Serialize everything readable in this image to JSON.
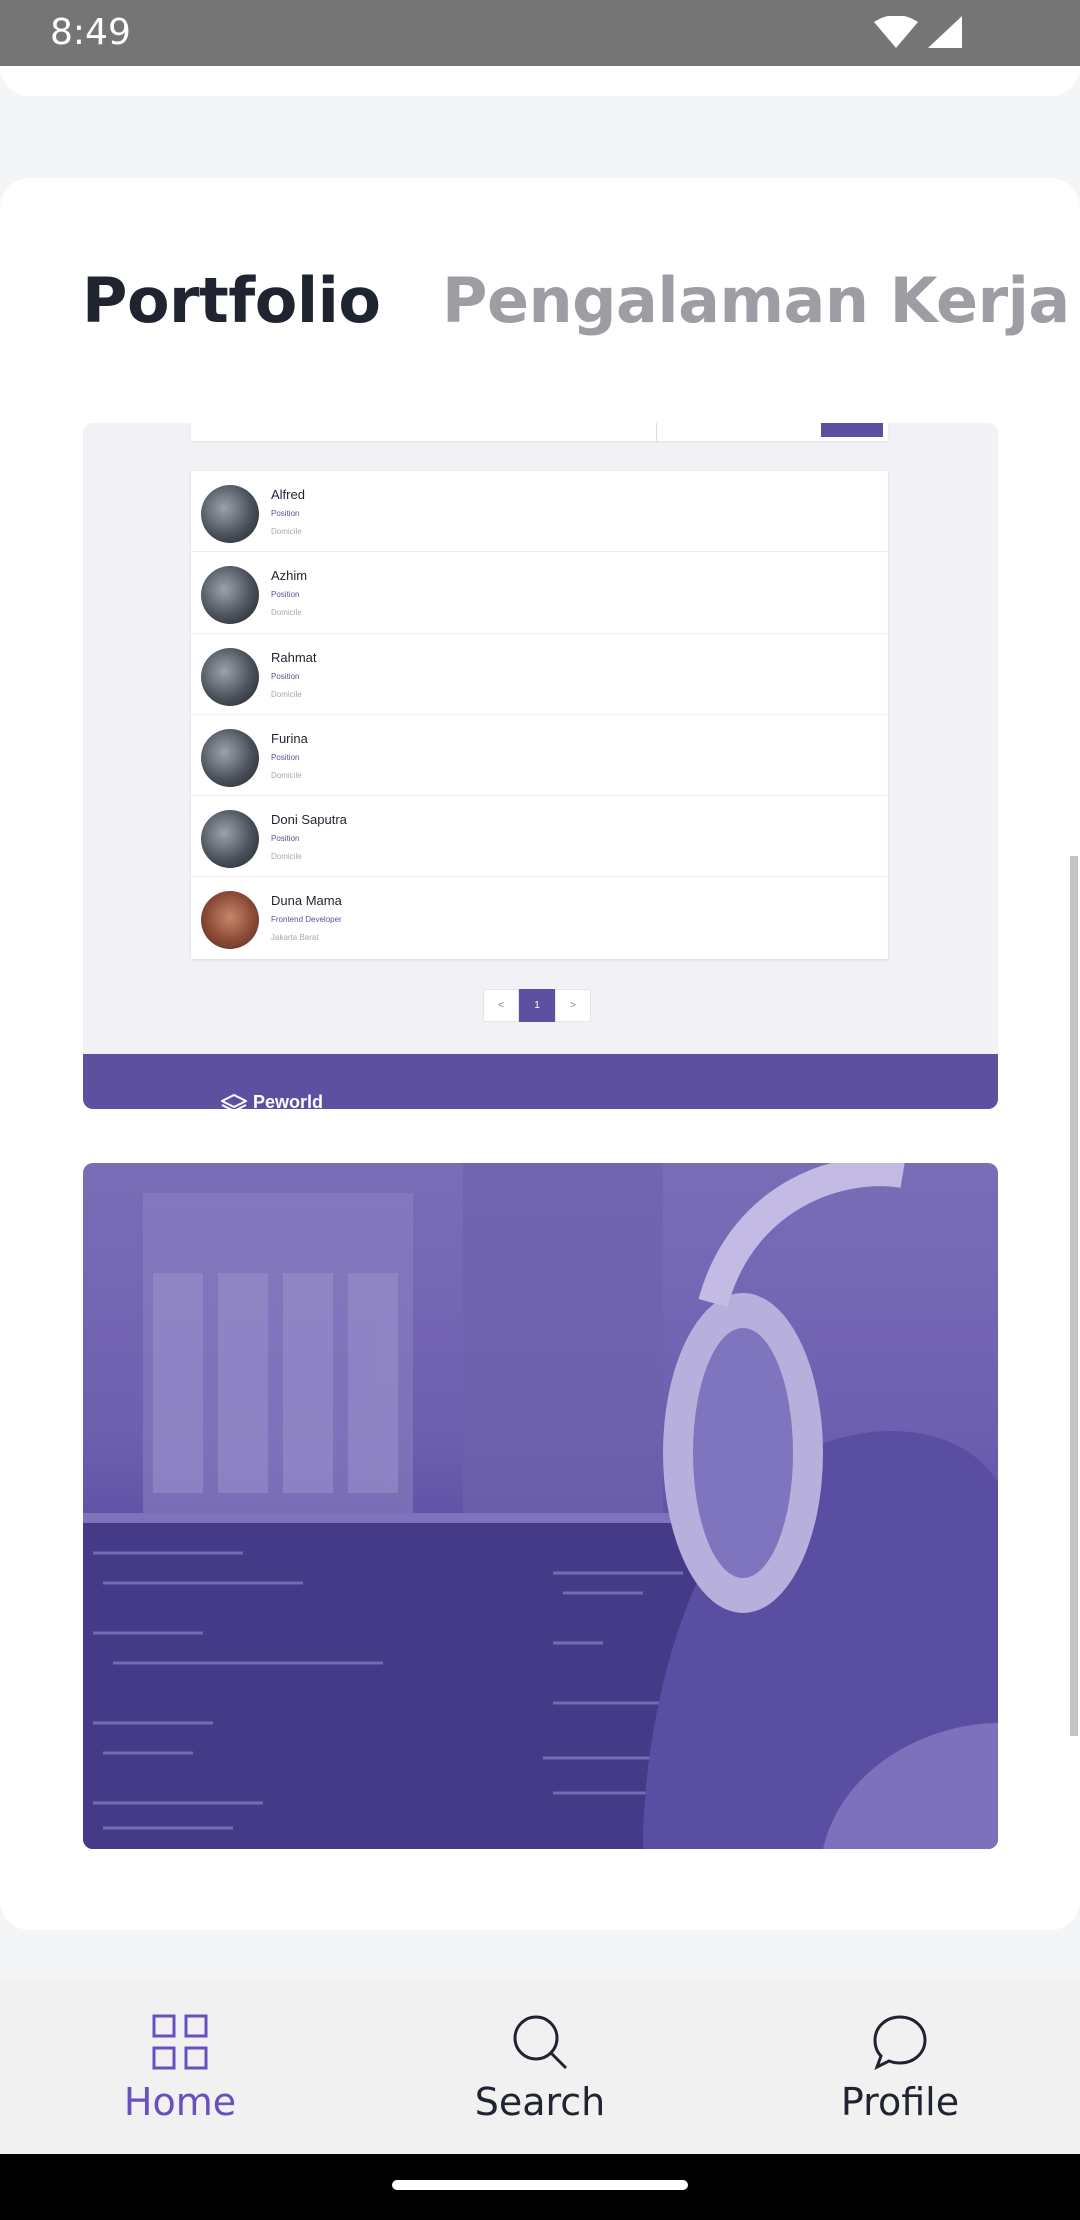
{
  "status_bar": {
    "time": "8:49"
  },
  "tabs": {
    "portfolio": "Portfolio",
    "experience": "Pengalaman Kerja"
  },
  "portfolio_shot": {
    "people": [
      {
        "name": "Alfred",
        "position": "Position",
        "domicile": "Domicile"
      },
      {
        "name": "Azhim",
        "position": "Position",
        "domicile": "Domicile"
      },
      {
        "name": "Rahmat",
        "position": "Position",
        "domicile": "Domicile"
      },
      {
        "name": "Furina",
        "position": "Position",
        "domicile": "Domicile"
      },
      {
        "name": "Doni Saputra",
        "position": "Position",
        "domicile": "Domicile"
      },
      {
        "name": "Duna Mama",
        "position": "Frontend Developer",
        "domicile": "Jakarta Barat"
      }
    ],
    "pagination": {
      "prev": "<",
      "current": "1",
      "next": ">"
    },
    "footer_brand": "Peworld"
  },
  "bottom_nav": {
    "home": "Home",
    "search": "Search",
    "profile": "Profile"
  },
  "colors": {
    "accent": "#5e50a1",
    "nav_active": "#6a4fc0"
  }
}
